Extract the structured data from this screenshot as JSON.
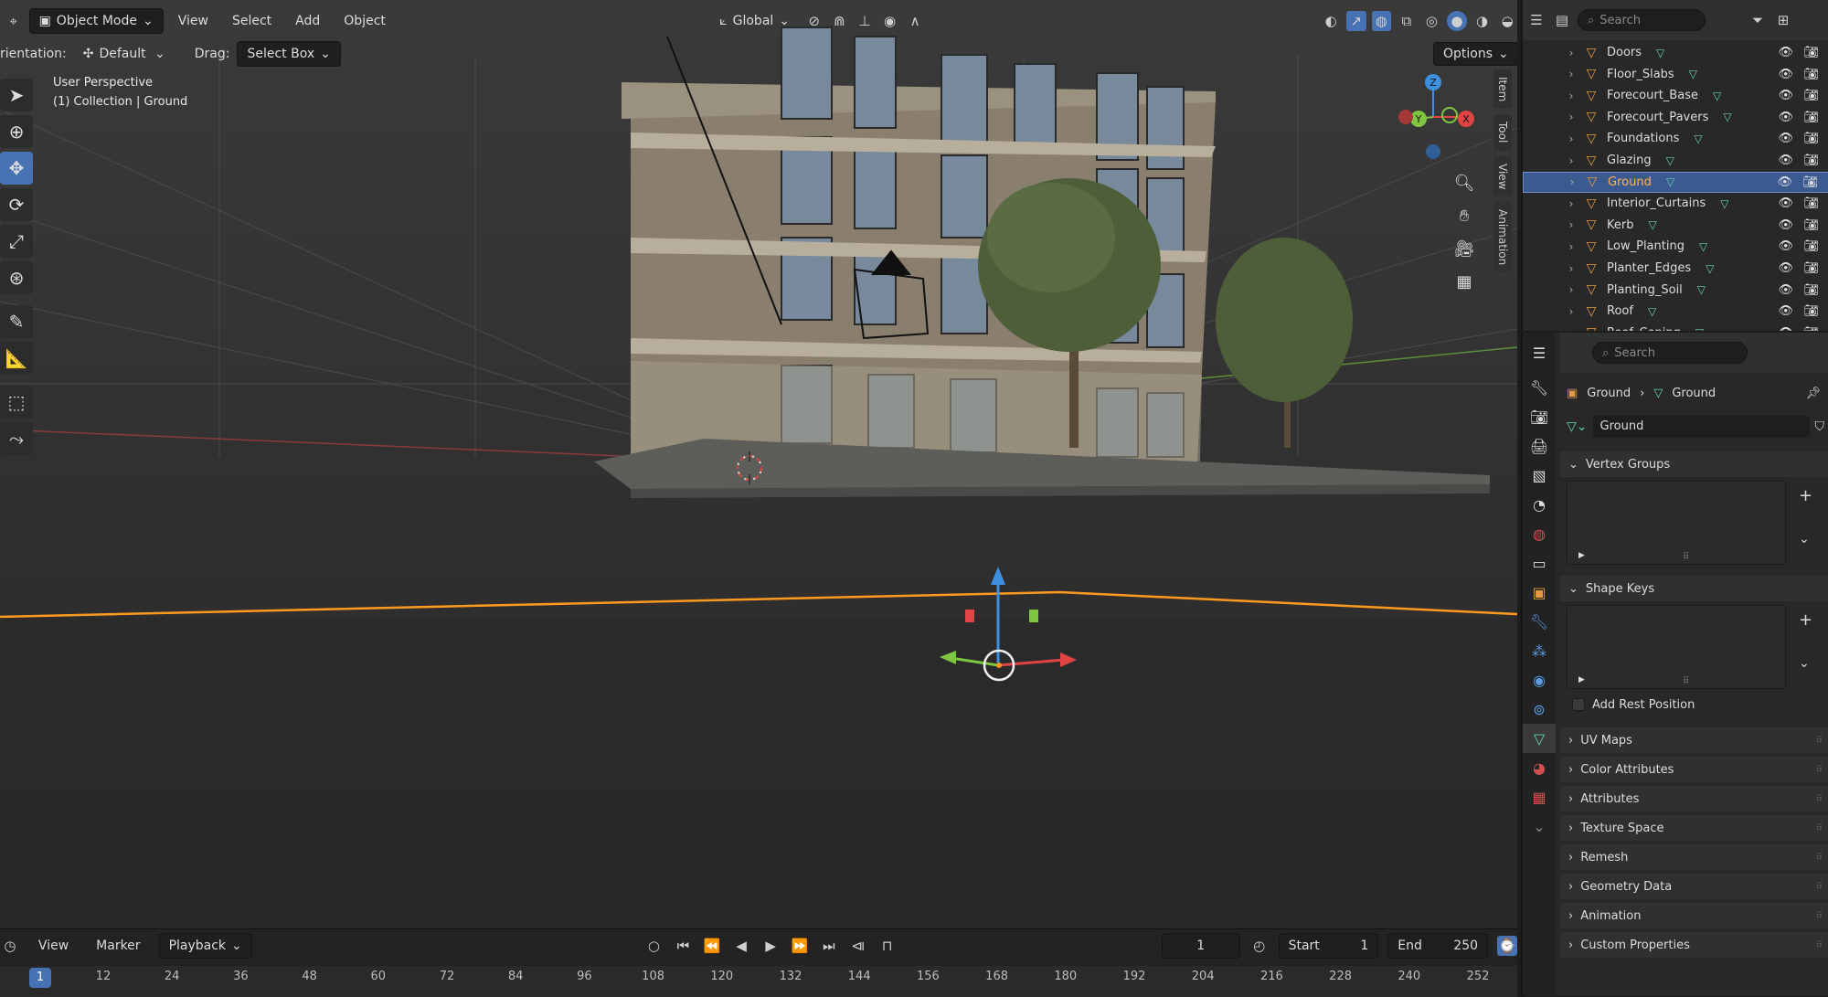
{
  "header": {
    "mode": "Object Mode",
    "menus": [
      "View",
      "Select",
      "Add",
      "Object"
    ],
    "transform_orientation": "Global"
  },
  "subheader": {
    "orientation_label": "rientation:",
    "orientation_value": "Default",
    "drag_label": "Drag:",
    "drag_value": "Select Box",
    "options": "Options"
  },
  "viewport": {
    "perspective": "User Perspective",
    "context": "(1) Collection | Ground",
    "side_tabs": [
      "Item",
      "Tool",
      "View",
      "Animation"
    ],
    "gizmo_axes": [
      "Z",
      "Y",
      "X"
    ]
  },
  "outliner": {
    "search_placeholder": "Search",
    "items": [
      {
        "name": "Doors",
        "selected": false
      },
      {
        "name": "Floor_Slabs",
        "selected": false
      },
      {
        "name": "Forecourt_Base",
        "selected": false
      },
      {
        "name": "Forecourt_Pavers",
        "selected": false
      },
      {
        "name": "Foundations",
        "selected": false
      },
      {
        "name": "Glazing",
        "selected": false
      },
      {
        "name": "Ground",
        "selected": true
      },
      {
        "name": "Interior_Curtains",
        "selected": false
      },
      {
        "name": "Kerb",
        "selected": false
      },
      {
        "name": "Low_Planting",
        "selected": false
      },
      {
        "name": "Planter_Edges",
        "selected": false
      },
      {
        "name": "Planting_Soil",
        "selected": false
      },
      {
        "name": "Roof",
        "selected": false
      },
      {
        "name": "Roof_Coping",
        "selected": false
      }
    ]
  },
  "properties": {
    "search_placeholder": "Search",
    "breadcrumb": {
      "object": "Ground",
      "data": "Ground"
    },
    "mesh_name": "Ground",
    "panels": {
      "vertex_groups": "Vertex Groups",
      "shape_keys": "Shape Keys",
      "add_rest_position": "Add Rest Position",
      "collapsed": [
        "UV Maps",
        "Color Attributes",
        "Attributes",
        "Texture Space",
        "Remesh",
        "Geometry Data",
        "Animation",
        "Custom Properties"
      ]
    }
  },
  "timeline": {
    "menus": [
      "View",
      "Marker",
      "Playback"
    ],
    "current_frame": "1",
    "start_label": "Start",
    "start": "1",
    "end_label": "End",
    "end": "250",
    "playhead": "1",
    "ruler": [
      "12",
      "24",
      "36",
      "48",
      "60",
      "72",
      "84",
      "96",
      "108",
      "120",
      "132",
      "144",
      "156",
      "168",
      "180",
      "192",
      "204",
      "216",
      "228",
      "240",
      "252"
    ]
  },
  "colors": {
    "accent": "#4772b3",
    "selection_text": "#ffb34d",
    "object_icon": "#e49b43",
    "mesh_icon": "#66d3ad",
    "selection_outline": "#ff9a1f"
  }
}
